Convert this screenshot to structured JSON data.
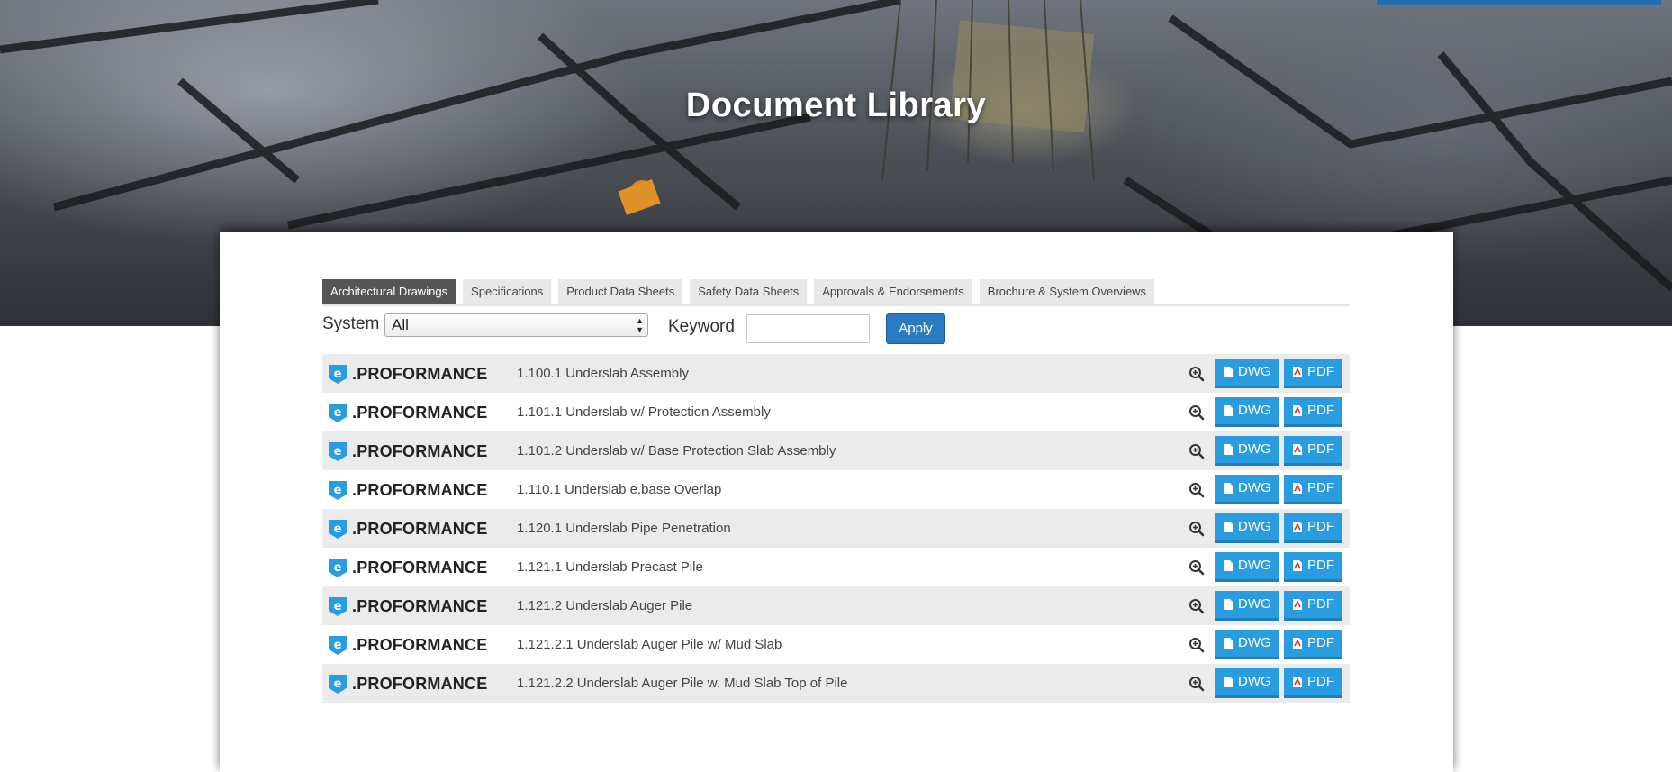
{
  "page": {
    "title": "Document Library"
  },
  "tabs": [
    {
      "label": "Architectural Drawings",
      "active": true
    },
    {
      "label": "Specifications",
      "active": false
    },
    {
      "label": "Product Data Sheets",
      "active": false
    },
    {
      "label": "Safety Data Sheets",
      "active": false
    },
    {
      "label": "Approvals & Endorsements",
      "active": false
    },
    {
      "label": "Brochure & System Overviews",
      "active": false
    }
  ],
  "filters": {
    "system_label": "System",
    "system_value": "All",
    "keyword_label": "Keyword",
    "keyword_value": "",
    "apply_label": "Apply"
  },
  "brand": {
    "logo_text": ".PROFORMANCE",
    "accent": "#2a9de0"
  },
  "documents": [
    {
      "title": "1.100.1 Underslab Assembly",
      "dwg": "DWG",
      "pdf": "PDF"
    },
    {
      "title": "1.101.1 Underslab w/ Protection Assembly",
      "dwg": "DWG",
      "pdf": "PDF"
    },
    {
      "title": "1.101.2 Underslab w/ Base Protection Slab Assembly",
      "dwg": "DWG",
      "pdf": "PDF"
    },
    {
      "title": "1.110.1 Underslab e.base Overlap",
      "dwg": "DWG",
      "pdf": "PDF"
    },
    {
      "title": "1.120.1 Underslab Pipe Penetration",
      "dwg": "DWG",
      "pdf": "PDF"
    },
    {
      "title": "1.121.1 Underslab Precast Pile",
      "dwg": "DWG",
      "pdf": "PDF"
    },
    {
      "title": "1.121.2 Underslab Auger Pile",
      "dwg": "DWG",
      "pdf": "PDF"
    },
    {
      "title": "1.121.2.1 Underslab Auger Pile w/ Mud Slab",
      "dwg": "DWG",
      "pdf": "PDF"
    },
    {
      "title": "1.121.2.2 Underslab Auger Pile w. Mud Slab Top of Pile",
      "dwg": "DWG",
      "pdf": "PDF"
    }
  ]
}
